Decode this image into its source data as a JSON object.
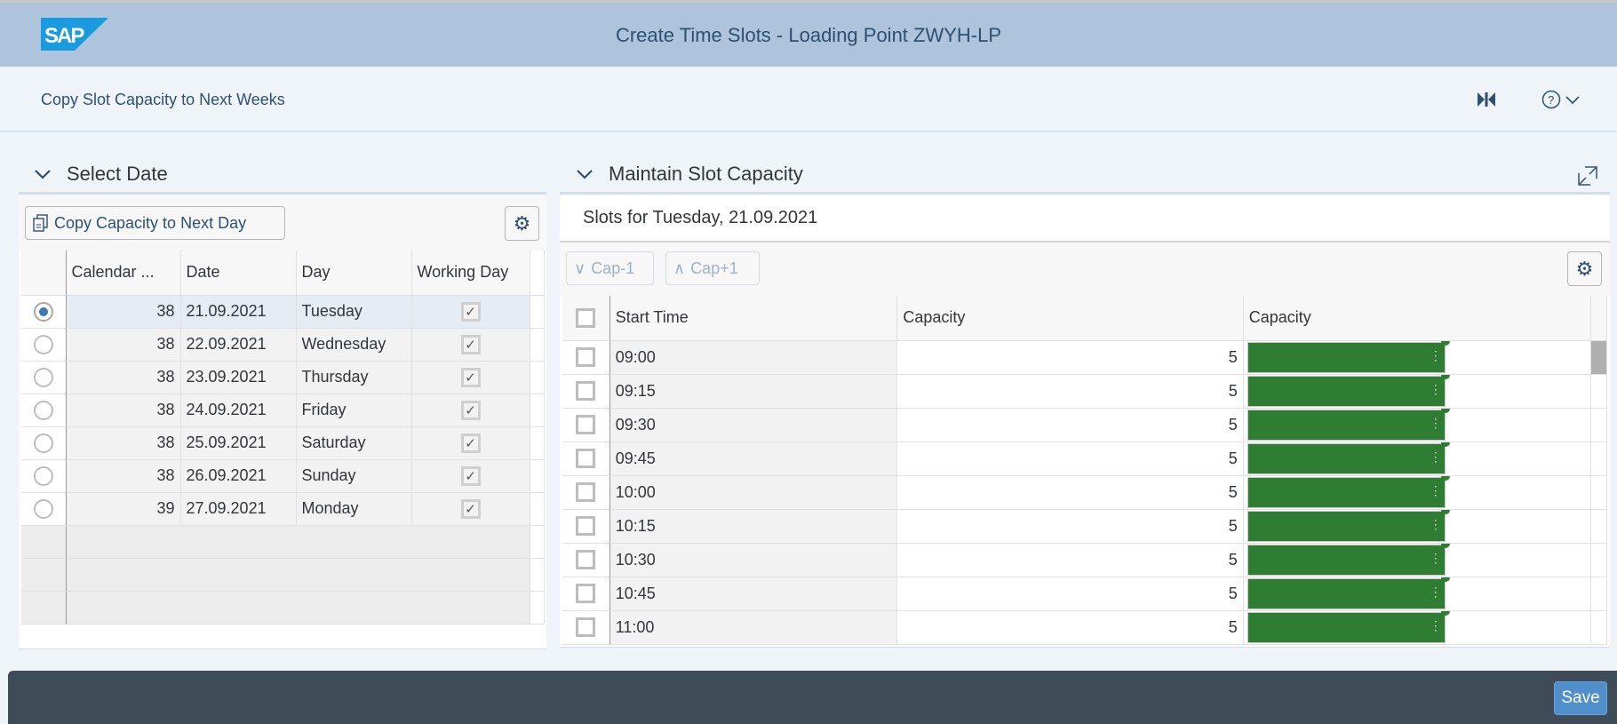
{
  "header": {
    "title": "Create Time Slots - Loading Point ZWYH-LP",
    "logo": "SAP"
  },
  "subheader": {
    "link": "Copy Slot Capacity to Next Weeks"
  },
  "left": {
    "title": "Select Date",
    "copy_button": "Copy Capacity to Next Day",
    "columns": [
      "Calendar ...",
      "Date",
      "Day",
      "Working Day"
    ],
    "rows": [
      {
        "week": "38",
        "date": "21.09.2021",
        "day": "Tuesday",
        "working": true,
        "selected": true
      },
      {
        "week": "38",
        "date": "22.09.2021",
        "day": "Wednesday",
        "working": true,
        "selected": false
      },
      {
        "week": "38",
        "date": "23.09.2021",
        "day": "Thursday",
        "working": true,
        "selected": false
      },
      {
        "week": "38",
        "date": "24.09.2021",
        "day": "Friday",
        "working": true,
        "selected": false
      },
      {
        "week": "38",
        "date": "25.09.2021",
        "day": "Saturday",
        "working": true,
        "selected": false
      },
      {
        "week": "38",
        "date": "26.09.2021",
        "day": "Sunday",
        "working": true,
        "selected": false
      },
      {
        "week": "39",
        "date": "27.09.2021",
        "day": "Monday",
        "working": true,
        "selected": false
      }
    ]
  },
  "right": {
    "title": "Maintain Slot Capacity",
    "subtitle": "Slots for Tuesday, 21.09.2021",
    "cap_minus": "Cap-1",
    "cap_plus": "Cap+1",
    "columns": [
      "Start Time",
      "Capacity",
      "Capacity"
    ],
    "bar_color": "#2e7d32",
    "rows": [
      {
        "time": "09:00",
        "capacity": "5"
      },
      {
        "time": "09:15",
        "capacity": "5"
      },
      {
        "time": "09:30",
        "capacity": "5"
      },
      {
        "time": "09:45",
        "capacity": "5"
      },
      {
        "time": "10:00",
        "capacity": "5"
      },
      {
        "time": "10:15",
        "capacity": "5"
      },
      {
        "time": "10:30",
        "capacity": "5"
      },
      {
        "time": "10:45",
        "capacity": "5"
      },
      {
        "time": "11:00",
        "capacity": "5"
      }
    ]
  },
  "footer": {
    "save": "Save"
  }
}
